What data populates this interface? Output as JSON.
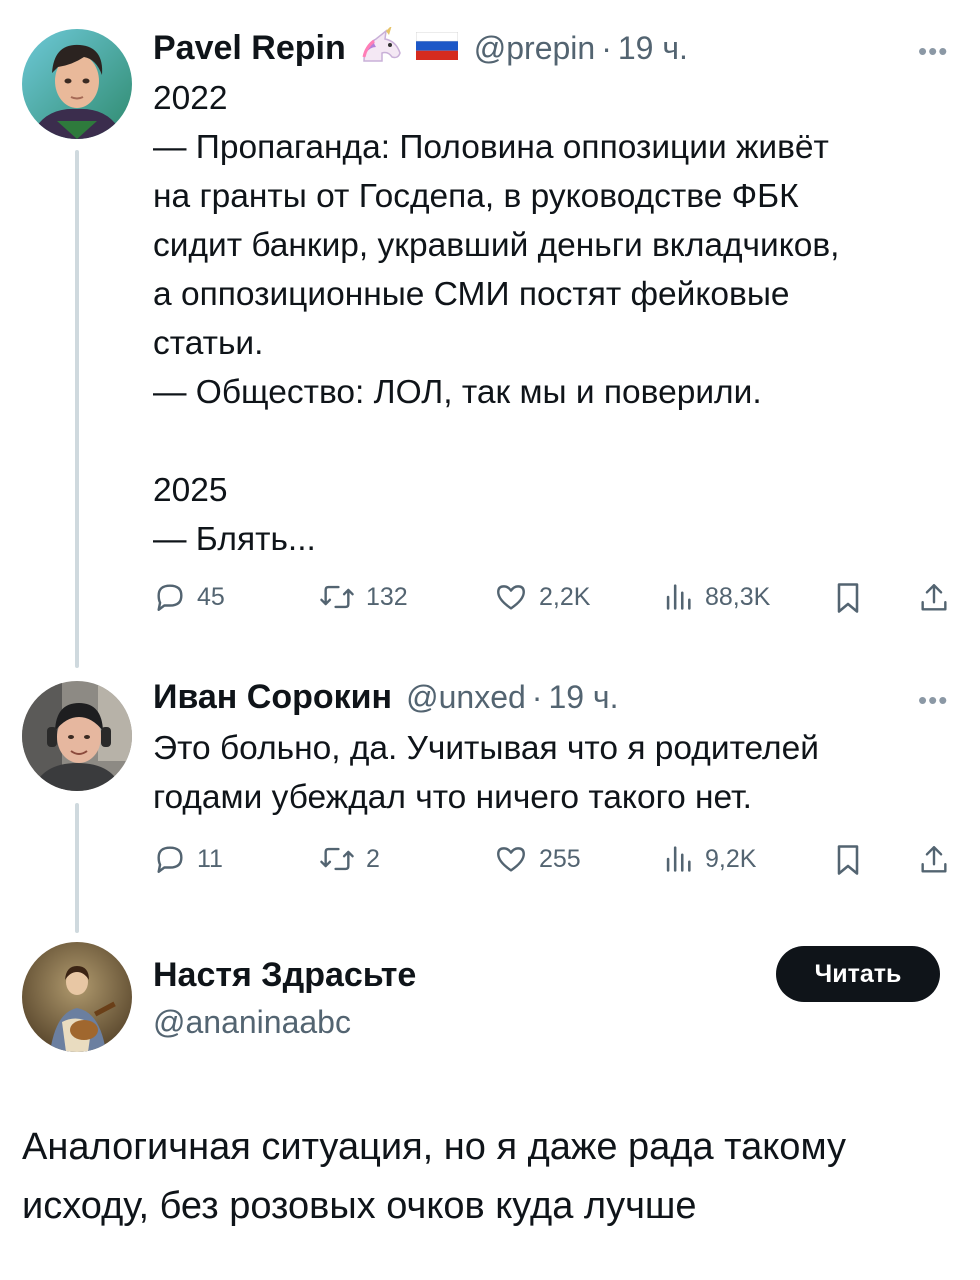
{
  "tweets": [
    {
      "author": {
        "name": "Pavel Repin",
        "handle": "@prepin",
        "time": "19 ч.",
        "badge_icons": [
          "unicorn-emoji",
          "russian-flag-emoji"
        ]
      },
      "text_lines": [
        "2022",
        "— Пропаганда: Половина оппозиции живёт",
        "на гранты от Госдепа, в руководстве ФБК",
        "сидит банкир, укравший деньги вкладчиков,",
        "а оппозиционные СМИ постят фейковые",
        "статьи.",
        "— Общество: ЛОЛ, так мы и поверили.",
        "",
        "2025",
        "— Блять..."
      ],
      "stats": {
        "replies": "45",
        "retweets": "132",
        "likes": "2,2K",
        "views": "88,3K"
      }
    },
    {
      "author": {
        "name": "Иван Сорокин",
        "handle": "@unxed",
        "time": "19 ч."
      },
      "text_lines": [
        "Это больно, да. Учитывая что я родителей",
        "годами убеждал что ничего такого нет."
      ],
      "stats": {
        "replies": "11",
        "retweets": "2",
        "likes": "255",
        "views": "9,2K"
      }
    }
  ],
  "profile_card": {
    "name": "Настя Здрасьте",
    "handle": "@ananinaabc",
    "follow_label": "Читать"
  },
  "caption_lines": [
    "Аналогичная ситуация, но я даже рада такому",
    "исходу, без розовых очков куда лучше"
  ],
  "colors": {
    "text": "#0f1419",
    "muted": "#536471",
    "thread_line": "#cfd9de",
    "button_bg": "#0f1419",
    "button_text": "#ffffff"
  },
  "icons": {
    "reply": "speech-bubble-icon",
    "retweet": "retweet-arrows-icon",
    "like": "heart-icon",
    "views": "bar-chart-icon",
    "bookmark": "bookmark-icon",
    "share": "share-upload-icon",
    "more": "more-dots-icon"
  }
}
